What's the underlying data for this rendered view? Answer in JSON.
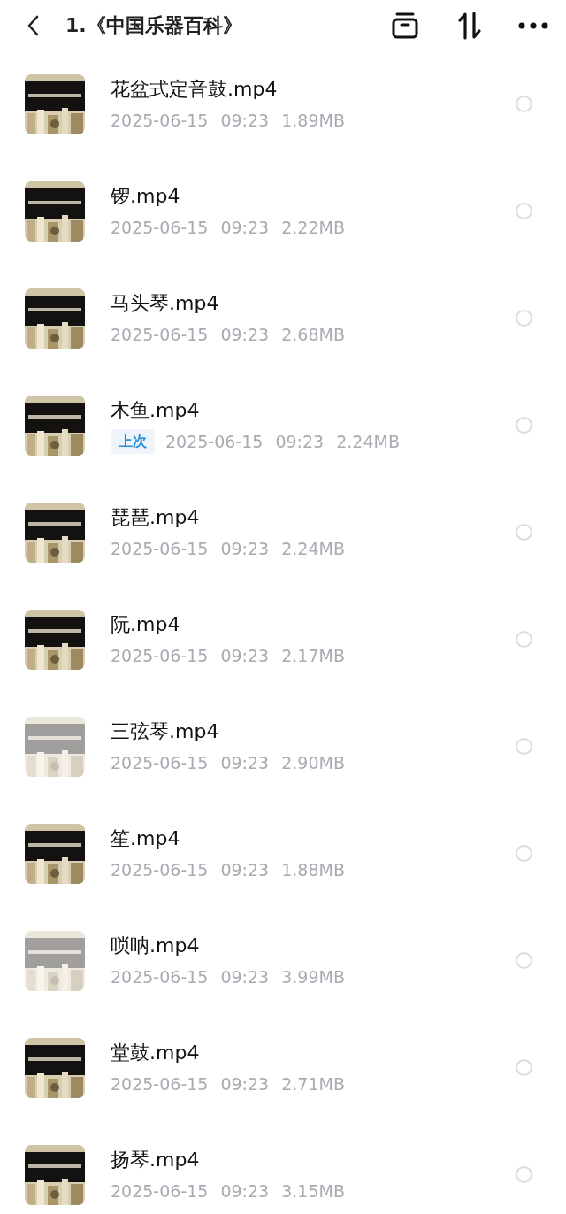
{
  "header": {
    "title": "1.《中国乐器百科》"
  },
  "files": [
    {
      "name": "花盆式定音鼓.mp4",
      "date": "2025-06-15",
      "time": "09:23",
      "size": "1.89MB",
      "dimmed": false,
      "selected": false
    },
    {
      "name": "锣.mp4",
      "date": "2025-06-15",
      "time": "09:23",
      "size": "2.22MB",
      "dimmed": false,
      "selected": false
    },
    {
      "name": "马头琴.mp4",
      "date": "2025-06-15",
      "time": "09:23",
      "size": "2.68MB",
      "dimmed": false,
      "selected": false
    },
    {
      "name": "木鱼.mp4",
      "badge": "上次",
      "date": "2025-06-15",
      "time": "09:23",
      "size": "2.24MB",
      "dimmed": false,
      "selected": false
    },
    {
      "name": "琵琶.mp4",
      "date": "2025-06-15",
      "time": "09:23",
      "size": "2.24MB",
      "dimmed": false,
      "selected": false
    },
    {
      "name": "阮.mp4",
      "date": "2025-06-15",
      "time": "09:23",
      "size": "2.17MB",
      "dimmed": false,
      "selected": false
    },
    {
      "name": "三弦琴.mp4",
      "date": "2025-06-15",
      "time": "09:23",
      "size": "2.90MB",
      "dimmed": true,
      "selected": false
    },
    {
      "name": "笙.mp4",
      "date": "2025-06-15",
      "time": "09:23",
      "size": "1.88MB",
      "dimmed": false,
      "selected": false
    },
    {
      "name": "唢呐.mp4",
      "date": "2025-06-15",
      "time": "09:23",
      "size": "3.99MB",
      "dimmed": true,
      "selected": false
    },
    {
      "name": "堂鼓.mp4",
      "date": "2025-06-15",
      "time": "09:23",
      "size": "2.71MB",
      "dimmed": false,
      "selected": false
    },
    {
      "name": "扬琴.mp4",
      "date": "2025-06-15",
      "time": "09:23",
      "size": "3.15MB",
      "dimmed": false,
      "selected": false
    }
  ]
}
